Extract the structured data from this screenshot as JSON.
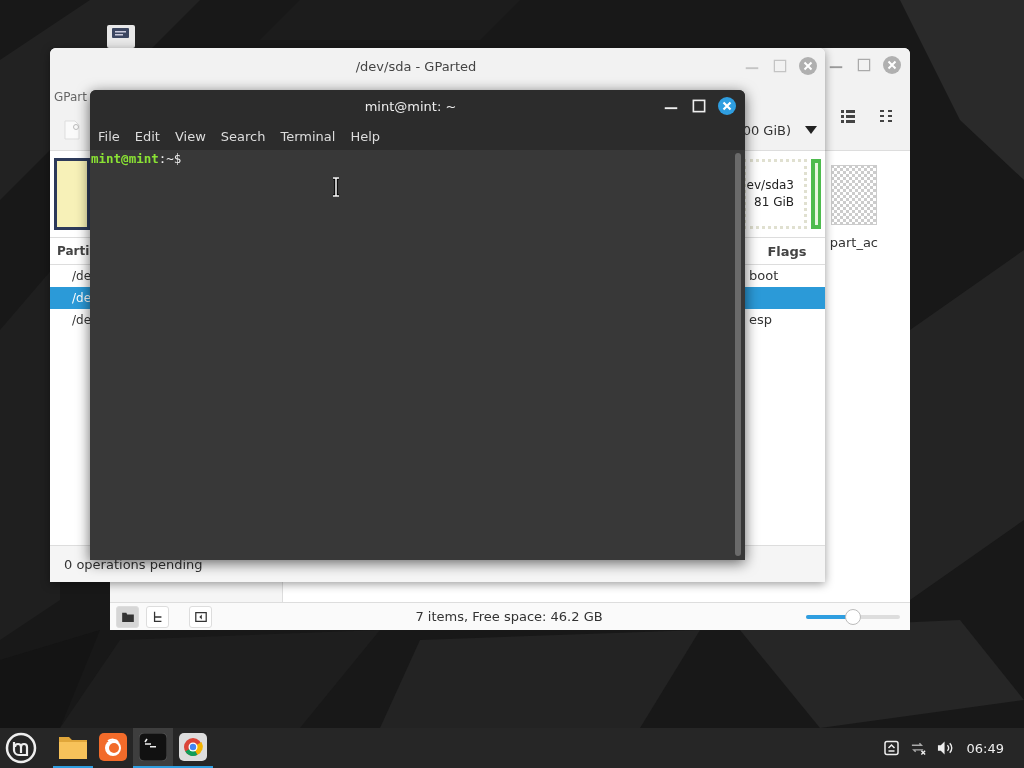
{
  "file_manager": {
    "files": [
      {
        "name": "part_ac"
      }
    ],
    "side_buttons": [
      {
        "kind": "places",
        "selected": true
      },
      {
        "kind": "tree",
        "selected": false
      }
    ],
    "status": "7 items, Free space: 46.2 GB",
    "zoom": {
      "level": 0.5
    }
  },
  "gparted": {
    "title": "/dev/sda - GParted",
    "menu": [
      "GPart"
    ],
    "device": "00 GiB)",
    "disk_map": [
      {
        "name": "ev/sda3",
        "size": "81 GiB"
      }
    ],
    "columns": [
      "Parti",
      "Flags"
    ],
    "rows": [
      {
        "partition": "/de",
        "flags": "boot",
        "selected": false
      },
      {
        "partition": "/de",
        "selected": true
      },
      {
        "partition": "/de",
        "flags": "esp",
        "selected": false
      }
    ],
    "status": "0 operations pending"
  },
  "terminal": {
    "title": "mint@mint: ~",
    "menu": [
      "File",
      "Edit",
      "View",
      "Search",
      "Terminal",
      "Help"
    ],
    "prompt_user": "mint@mint",
    "prompt_path": ":~$"
  },
  "taskbar": {
    "apps": [
      {
        "kind": "files",
        "running": true,
        "active": false
      },
      {
        "kind": "firefox",
        "running": false,
        "active": false
      },
      {
        "kind": "terminal",
        "running": true,
        "active": true
      },
      {
        "kind": "chrome",
        "running": true,
        "active": false
      }
    ],
    "clock": "06:49"
  }
}
